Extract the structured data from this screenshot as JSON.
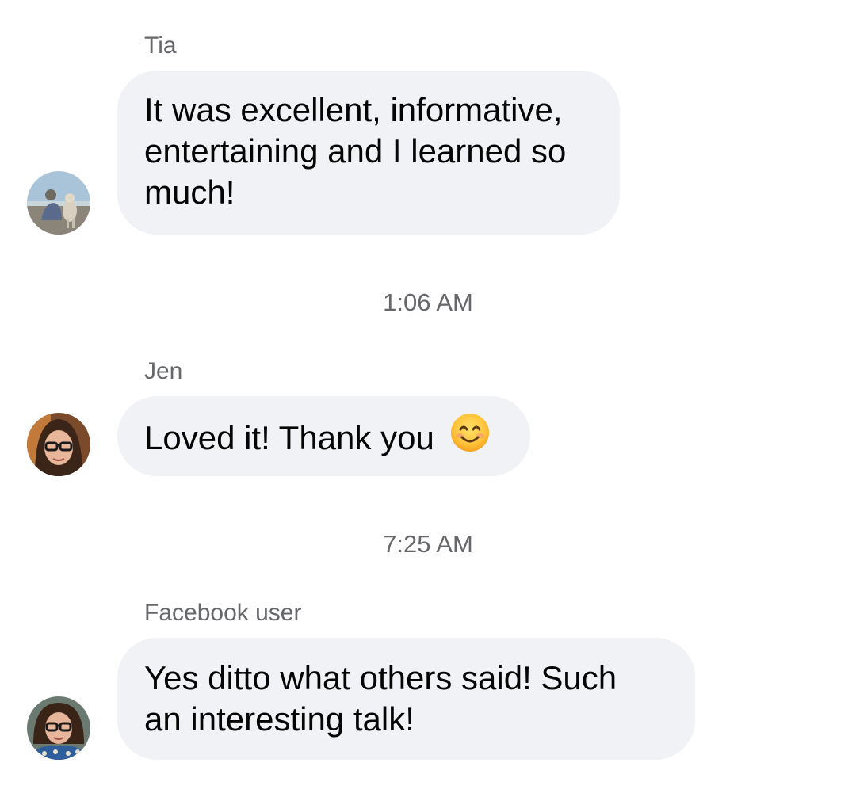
{
  "messages": [
    {
      "sender": "Tia",
      "lines": [
        "It was excellent, informative,",
        "entertaining and I learned so",
        "much!"
      ],
      "avatar": "avatar-tia-beach-dog"
    },
    {
      "sender": "Jen",
      "text": "Loved it! Thank you",
      "emoji": "smiling-face-emoji",
      "avatar": "avatar-jen-glasses"
    },
    {
      "sender": "Facebook user",
      "lines": [
        "Yes ditto what others said! Such",
        "an interesting talk!"
      ],
      "avatar": "avatar-facebook-user-glasses"
    }
  ],
  "timestamps": [
    "1:06 AM",
    "7:25 AM"
  ],
  "colors": {
    "bubble": "#f0f2f5",
    "secondary_text": "#65676b",
    "primary_text": "#050505"
  }
}
